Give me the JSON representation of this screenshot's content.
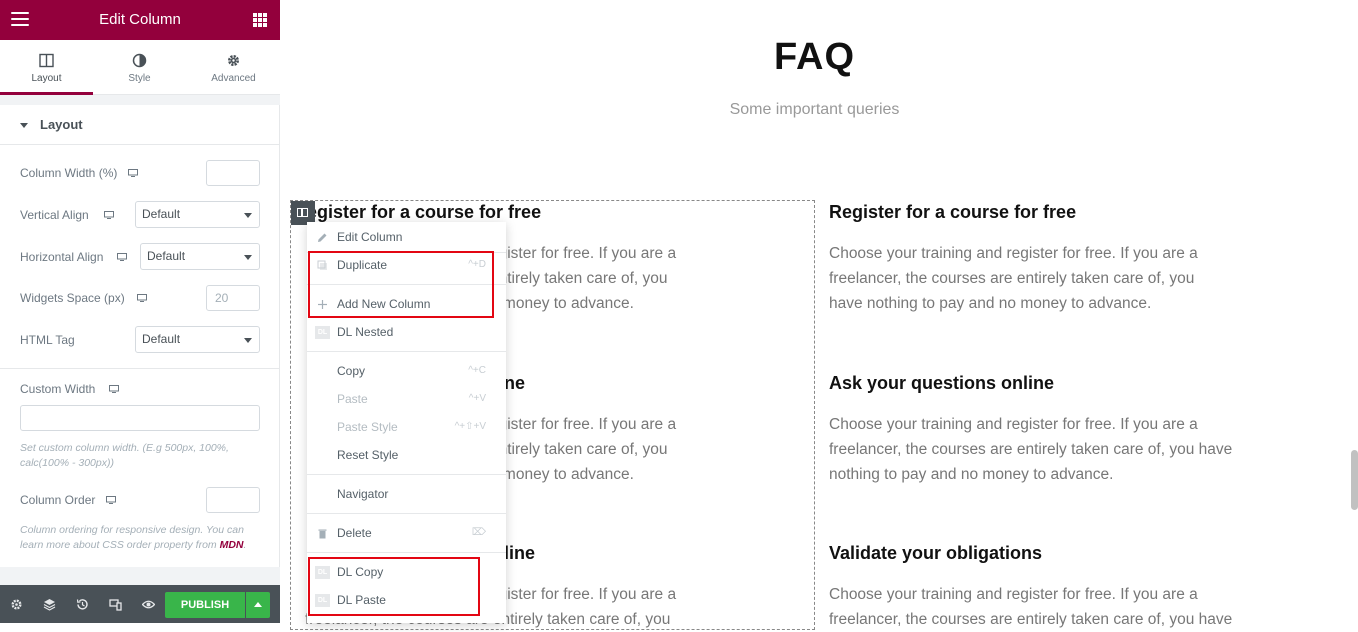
{
  "panel": {
    "title": "Edit Column",
    "tabs": [
      {
        "label": "Layout",
        "icon": "columns-icon"
      },
      {
        "label": "Style",
        "icon": "half-circle-icon"
      },
      {
        "label": "Advanced",
        "icon": "gear-icon"
      }
    ],
    "section_title": "Layout",
    "controls": {
      "column_width": {
        "label": "Column Width (%)",
        "value": ""
      },
      "vertical_align": {
        "label": "Vertical Align",
        "value": "Default"
      },
      "horizontal_align": {
        "label": "Horizontal Align",
        "value": "Default"
      },
      "widgets_space": {
        "label": "Widgets Space (px)",
        "placeholder": "20"
      },
      "html_tag": {
        "label": "HTML Tag",
        "value": "Default"
      },
      "custom_width": {
        "label": "Custom Width",
        "value": "",
        "help": "Set custom column width. (E.g 500px, 100%, calc(100% - 300px))"
      },
      "column_order": {
        "label": "Column Order",
        "value": "",
        "help_prefix": "Column ordering for responsive design. You can learn more about CSS order property from ",
        "help_link": "MDN",
        "help_suffix": "."
      }
    },
    "footer": {
      "publish_label": "PUBLISH"
    }
  },
  "preview": {
    "title": "FAQ",
    "subtitle": "Some important queries",
    "left_column": [
      {
        "title": "egister for a course for free",
        "lines": [
          "egister for free. If you are a",
          "entirely taken care of, you",
          "o money to advance."
        ]
      },
      {
        "title": "ne",
        "lines": [
          "egister for free. If you are a",
          "entirely taken care of, you",
          "o money to advance."
        ]
      },
      {
        "title": "line",
        "lines": [
          "egister for free. If you are a",
          "freelancer, the courses are entirely taken care of, you"
        ]
      }
    ],
    "right_column": [
      {
        "title": "Register for a course for free",
        "lines": [
          "Choose your training and register for free. If you are a",
          "freelancer, the courses are entirely taken care of, you",
          "have nothing to pay and no money to advance."
        ]
      },
      {
        "title": "Ask your questions online",
        "lines": [
          "Choose your training and register for free. If you are a",
          "freelancer, the courses are entirely taken care of, you have",
          "nothing to pay and no money to advance."
        ]
      },
      {
        "title": "Validate your obligations",
        "lines": [
          "Choose your training and register for free. If you are a",
          "freelancer, the courses are entirely taken care of, you have"
        ]
      }
    ]
  },
  "context_menu": {
    "items": [
      {
        "label": "Edit Column",
        "shortcut": "",
        "icon": "pencil-icon",
        "disabled": false
      },
      {
        "label": "Duplicate",
        "shortcut": "^+D",
        "icon": "copy-icon",
        "disabled": false
      },
      {
        "label": "Add New Column",
        "shortcut": "",
        "icon": "plus-icon",
        "disabled": false
      },
      {
        "label": "DL Nested",
        "shortcut": "",
        "icon": "dl-icon",
        "disabled": false
      },
      {
        "label": "Copy",
        "shortcut": "^+C",
        "icon": "",
        "disabled": false
      },
      {
        "label": "Paste",
        "shortcut": "^+V",
        "icon": "",
        "disabled": true
      },
      {
        "label": "Paste Style",
        "shortcut": "^+⇧+V",
        "icon": "",
        "disabled": true
      },
      {
        "label": "Reset Style",
        "shortcut": "",
        "icon": "",
        "disabled": false
      },
      {
        "label": "Navigator",
        "shortcut": "",
        "icon": "",
        "disabled": false
      },
      {
        "label": "Delete",
        "shortcut": "⌦",
        "icon": "trash-icon",
        "disabled": false
      },
      {
        "label": "DL Copy",
        "shortcut": "",
        "icon": "dl-icon",
        "disabled": false
      },
      {
        "label": "DL Paste",
        "shortcut": "",
        "icon": "dl-icon",
        "disabled": false
      }
    ],
    "dl_badge": "DL"
  },
  "colors": {
    "brand": "#93003c",
    "publish": "#39b54a",
    "highlight": "#e30613",
    "footer": "#495157"
  }
}
